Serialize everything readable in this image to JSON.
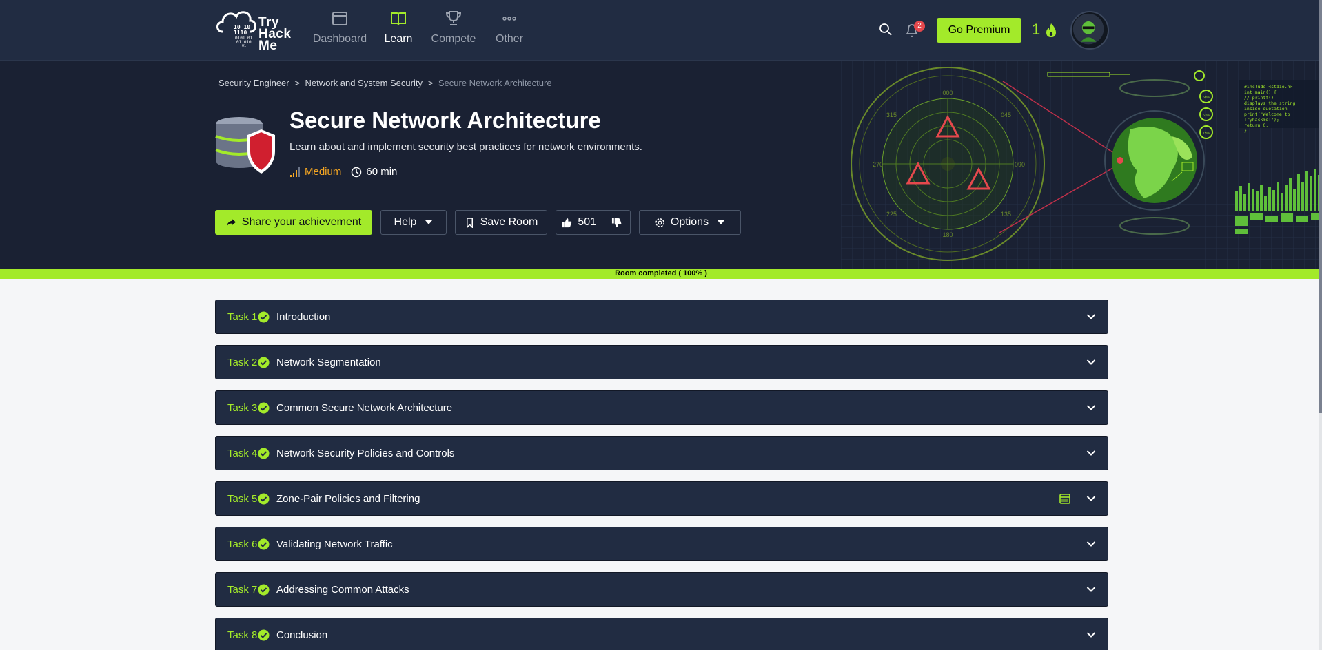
{
  "nav": {
    "logo_text": "Try Hack Me",
    "logo_binary": [
      "10  10",
      "1110",
      "0101 01",
      "01 010",
      "01"
    ],
    "items": [
      {
        "label": "Dashboard",
        "icon": "dashboard-icon",
        "active": false
      },
      {
        "label": "Learn",
        "icon": "book-icon",
        "active": true
      },
      {
        "label": "Compete",
        "icon": "trophy-icon",
        "active": false
      },
      {
        "label": "Other",
        "icon": "more-dots-icon",
        "active": false
      }
    ],
    "notification_count": "2",
    "premium_label": "Go Premium",
    "streak": "1"
  },
  "breadcrumb": {
    "items": [
      "Security Engineer",
      "Network and System Security"
    ],
    "current": "Secure Network Architecture",
    "separator": ">"
  },
  "room": {
    "title": "Secure Network Architecture",
    "description": "Learn about and implement security best practices for network environments.",
    "difficulty": "Medium",
    "duration": "60 min"
  },
  "actions": {
    "share_label": "Share your achievement",
    "help_label": "Help",
    "save_label": "Save Room",
    "upvotes": "501",
    "options_label": "Options"
  },
  "progress": {
    "label": "Room completed ( 100% )",
    "percent": 100
  },
  "hero_art": {
    "radar_labels": [
      "000",
      "045",
      "090",
      "135",
      "180",
      "225",
      "270",
      "315"
    ],
    "code_lines": [
      "#include <stdio.h>",
      "int main() {",
      "  // printf()",
      "displays the string",
      "inside quotation",
      "  print(\"Welcome to",
      "Tryhackme!\");",
      "  return 0;",
      "}"
    ],
    "gauge_labels": [
      "68%",
      "63%",
      "75%"
    ]
  },
  "tasks": [
    {
      "num": "Task 1",
      "title": "Introduction",
      "completed": true
    },
    {
      "num": "Task 2",
      "title": "Network Segmentation",
      "completed": true
    },
    {
      "num": "Task 3",
      "title": "Common Secure Network Architecture",
      "completed": true
    },
    {
      "num": "Task 4",
      "title": "Network Security Policies and Controls",
      "completed": true
    },
    {
      "num": "Task 5",
      "title": "Zone-Pair Policies and Filtering",
      "completed": true,
      "has_machine": true
    },
    {
      "num": "Task 6",
      "title": "Validating Network Traffic",
      "completed": true
    },
    {
      "num": "Task 7",
      "title": "Addressing Common Attacks",
      "completed": true
    },
    {
      "num": "Task 8",
      "title": "Conclusion",
      "completed": true
    }
  ],
  "colors": {
    "accent": "#a3ea2a",
    "nav_bg": "#212c42",
    "hero_bg": "#1a2133",
    "difficulty": "#f5a623",
    "danger": "#e5484d"
  }
}
